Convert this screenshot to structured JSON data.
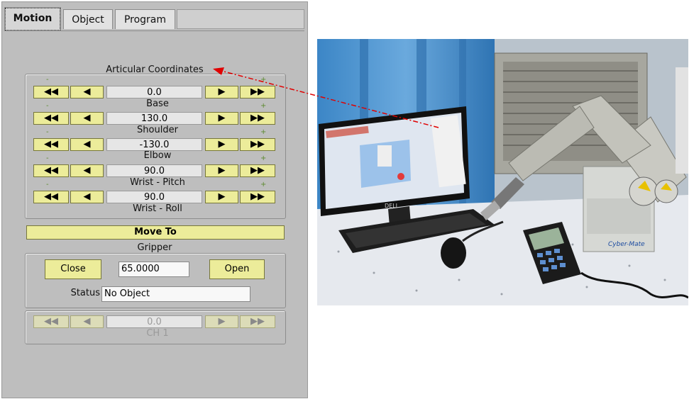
{
  "tabs": [
    {
      "label": "Motion"
    },
    {
      "label": "Object"
    },
    {
      "label": "Program"
    }
  ],
  "articular": {
    "title": "Articular Coordinates",
    "minus": "-",
    "plus": "+",
    "fast_left": "◀◀",
    "left": "◀",
    "right": "▶",
    "fast_right": "▶▶",
    "joints": [
      {
        "name": "Base",
        "value": "0.0"
      },
      {
        "name": "Shoulder",
        "value": "130.0"
      },
      {
        "name": "Elbow",
        "value": "-130.0"
      },
      {
        "name": "Wrist - Pitch",
        "value": "90.0"
      },
      {
        "name": "Wrist - Roll",
        "value": "90.0"
      }
    ]
  },
  "move_to": "Move To",
  "gripper": {
    "title": "Gripper",
    "close_label": "Close",
    "value": "65.0000",
    "open_label": "Open",
    "status_label": "Status",
    "status_value": "No Object"
  },
  "channel": {
    "value": "0.0",
    "name": "CH 1"
  },
  "photo": {
    "monitor_brand": "DELL",
    "controller_label": "Cyber-Mate"
  },
  "colors": {
    "panel": "#bebebe",
    "button": "#ecec9a",
    "annotation": "#e00000"
  }
}
